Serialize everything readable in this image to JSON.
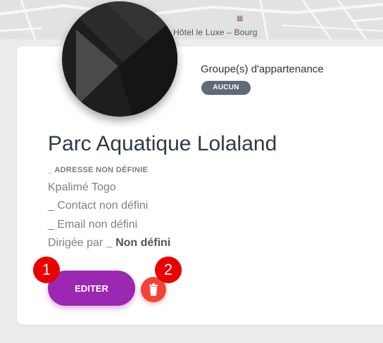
{
  "map": {
    "place_label": "Hôtel le Luxe – Bourg"
  },
  "group": {
    "title": "Groupe(s) d'appartenance",
    "badge": "AUCUN"
  },
  "venue": {
    "name": "Parc Aquatique Lolaland",
    "address": "_ ADRESSE NON DÉFINIE",
    "city": "Kpalimé Togo",
    "contact": "_ Contact non défini",
    "email": "_ Email non défini",
    "directed_prefix": "Dirigée par",
    "directed_value": "_ Non défini"
  },
  "actions": {
    "edit_label": "EDITER"
  },
  "markers": {
    "one": "1",
    "two": "2"
  },
  "colors": {
    "edit": "#9c27b0",
    "delete": "#f44336",
    "badge": "#5f6b77",
    "marker": "#ea0000"
  },
  "icons": {
    "delete": "trash-icon",
    "map_place": "hotel-icon"
  }
}
